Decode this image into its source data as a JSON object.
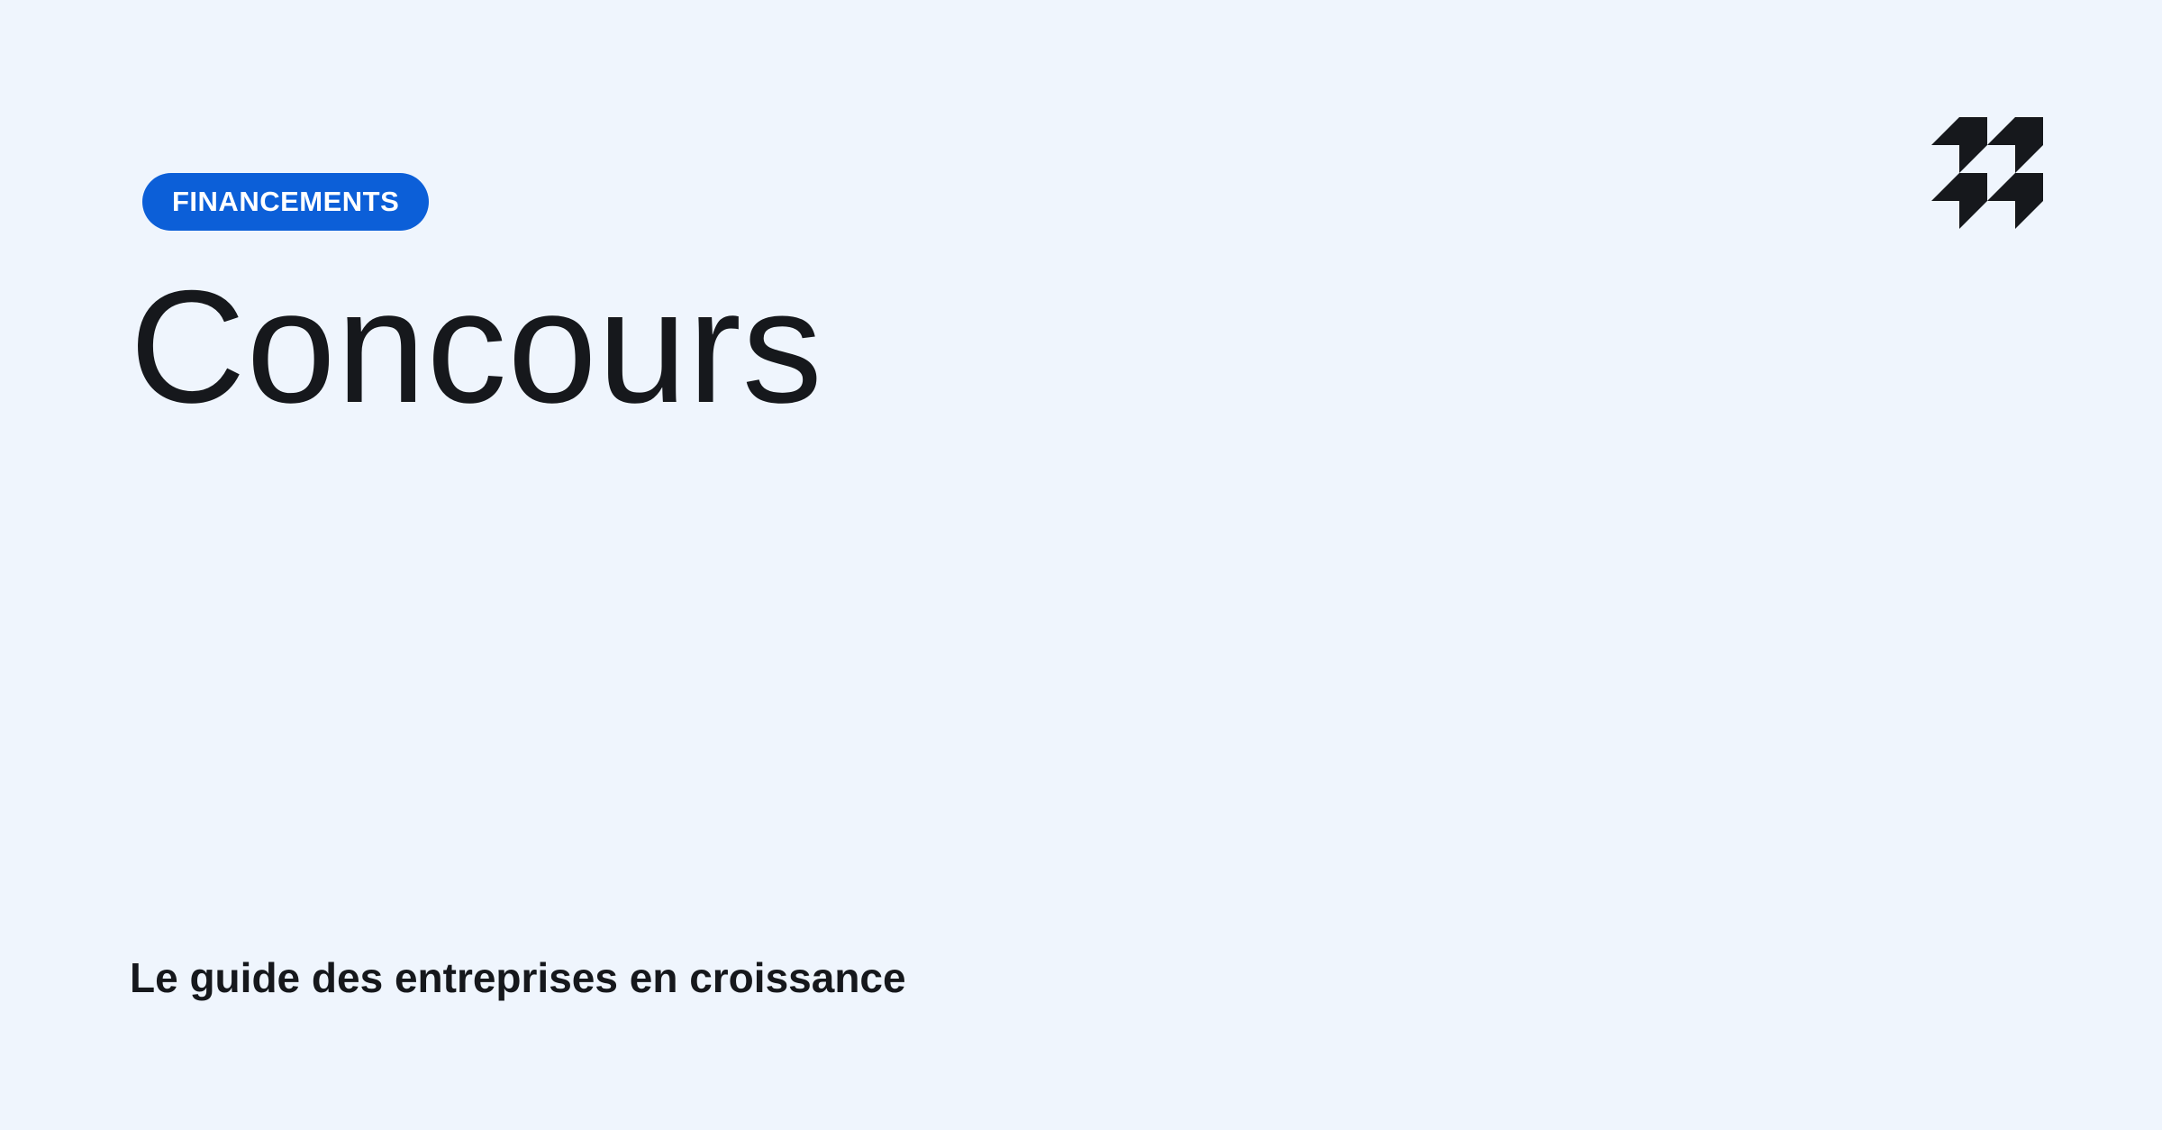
{
  "category": {
    "label": "FINANCEMENTS"
  },
  "title": "Concours",
  "tagline": "Le guide des entreprises en croissance",
  "logo": {
    "icon": "brand-logo-icon"
  },
  "colors": {
    "background": "#EFF5FD",
    "badge": "#0C5FD8",
    "badge_text": "#FFFFFF",
    "text": "#16181C",
    "logo": "#16181C"
  }
}
